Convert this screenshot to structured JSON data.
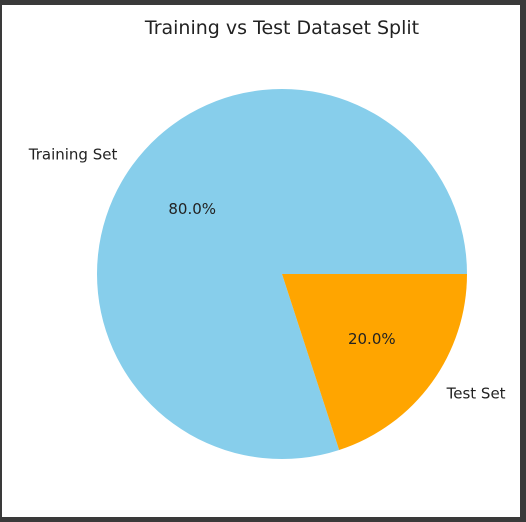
{
  "chart_data": {
    "type": "pie",
    "title": "Training vs Test Dataset Split",
    "labels": [
      "Training Set",
      "Test Set"
    ],
    "values": [
      80.0,
      20.0
    ],
    "pct_labels": [
      "80.0%",
      "20.0%"
    ],
    "colors": [
      "#87ceeb",
      "#ffa500"
    ],
    "start_angle_deg": 0,
    "direction": "counterclockwise",
    "legend": "none"
  }
}
